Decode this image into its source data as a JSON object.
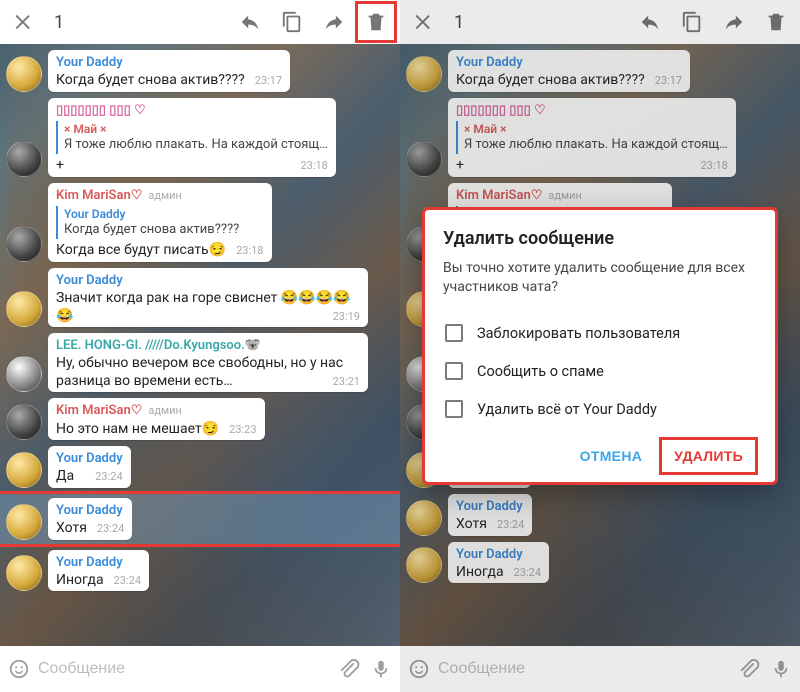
{
  "topbar": {
    "count": "1"
  },
  "input": {
    "placeholder": "Сообщение"
  },
  "messages": [
    {
      "name": "Your Daddy",
      "nameClass": "c-blue",
      "text": "Когда будет снова актив????",
      "time": "23:17",
      "avatar": "gold"
    },
    {
      "name": "▯▯▯▯▯▯▯ ▯▯▯ ♡",
      "nameClass": "c-pink",
      "quoteName": "× Май ×",
      "quoteNameClass": "c-red",
      "quoteText": "Я тоже люблю плакать. На каждой стоящ…",
      "text": "+",
      "time": "23:18",
      "avatar": "dark"
    },
    {
      "name": "Kim MariSan♡",
      "nameClass": "c-red",
      "admin": "админ",
      "quoteName": "Your Daddy",
      "quoteNameClass": "c-blue",
      "quoteText": "Когда будет снова актив????",
      "text": "Когда все будут писать😏",
      "time": "23:18",
      "avatar": "dark"
    },
    {
      "name": "Your Daddy",
      "nameClass": "c-blue",
      "text": "Значит когда рак на горе свиснет 😂😂😂😂😂",
      "time": "23:19",
      "avatar": "gold"
    },
    {
      "name": "LEE. HONG-GI. /////Do.Kyungsoo.🐨",
      "nameClass": "c-teal",
      "text": "Ну, обычно вечером все свободны, но у нас разница во времени есть…",
      "time": "23:21",
      "avatar": "bw"
    },
    {
      "name": "Kim MariSan♡",
      "nameClass": "c-red",
      "admin": "админ",
      "text": "Но это нам не мешает😏",
      "time": "23:23",
      "avatar": "dark"
    },
    {
      "name": "Your Daddy",
      "nameClass": "c-blue",
      "text": "Да",
      "time": "23:24",
      "avatar": "gold"
    },
    {
      "name": "Your Daddy",
      "nameClass": "c-blue",
      "text": "Хотя",
      "time": "23:24",
      "avatar": "gold",
      "selected": true
    },
    {
      "name": "Your Daddy",
      "nameClass": "c-blue",
      "text": "Иногда",
      "time": "23:24",
      "avatar": "gold"
    }
  ],
  "dialog": {
    "title": "Удалить сообщение",
    "text": "Вы точно хотите удалить сообщение для всех участников чата?",
    "opt1": "Заблокировать пользователя",
    "opt2": "Сообщить о спаме",
    "opt3": "Удалить всё от Your Daddy",
    "cancel": "ОТМЕНА",
    "delete": "УДАЛИТЬ"
  }
}
